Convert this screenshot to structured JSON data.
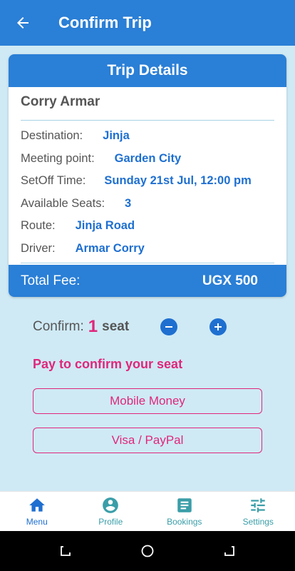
{
  "header": {
    "title": "Confirm Trip"
  },
  "card": {
    "title": "Trip Details",
    "passenger": "Corry Armar",
    "rows": [
      {
        "label": "Destination:",
        "value": "Jinja"
      },
      {
        "label": "Meeting point:",
        "value": "Garden City"
      },
      {
        "label": "SetOff Time:",
        "value": "Sunday 21st Jul, 12:00 pm"
      },
      {
        "label": "Available Seats:",
        "value": "3"
      },
      {
        "label": "Route:",
        "value": "Jinja Road"
      },
      {
        "label": "Driver:",
        "value": "Armar Corry"
      }
    ],
    "total_label": "Total Fee:",
    "total_value": "UGX 500"
  },
  "confirm": {
    "label": "Confirm:",
    "count": "1",
    "unit": "seat"
  },
  "payment": {
    "heading": "Pay to confirm your seat",
    "mobile_money": "Mobile Money",
    "visa_paypal": "Visa / PayPal"
  },
  "nav": {
    "items": [
      {
        "label": "Menu",
        "icon": "home-icon",
        "active": true
      },
      {
        "label": "Profile",
        "icon": "account-icon",
        "active": false
      },
      {
        "label": "Bookings",
        "icon": "bookings-icon",
        "active": false
      },
      {
        "label": "Settings",
        "icon": "settings-icon",
        "active": false
      }
    ]
  },
  "colors": {
    "primary": "#2a7fd6",
    "accent": "#e0267c",
    "background": "#cfeaf5",
    "value_text": "#1e6fd0",
    "nav_inactive": "#3a9ea8"
  }
}
